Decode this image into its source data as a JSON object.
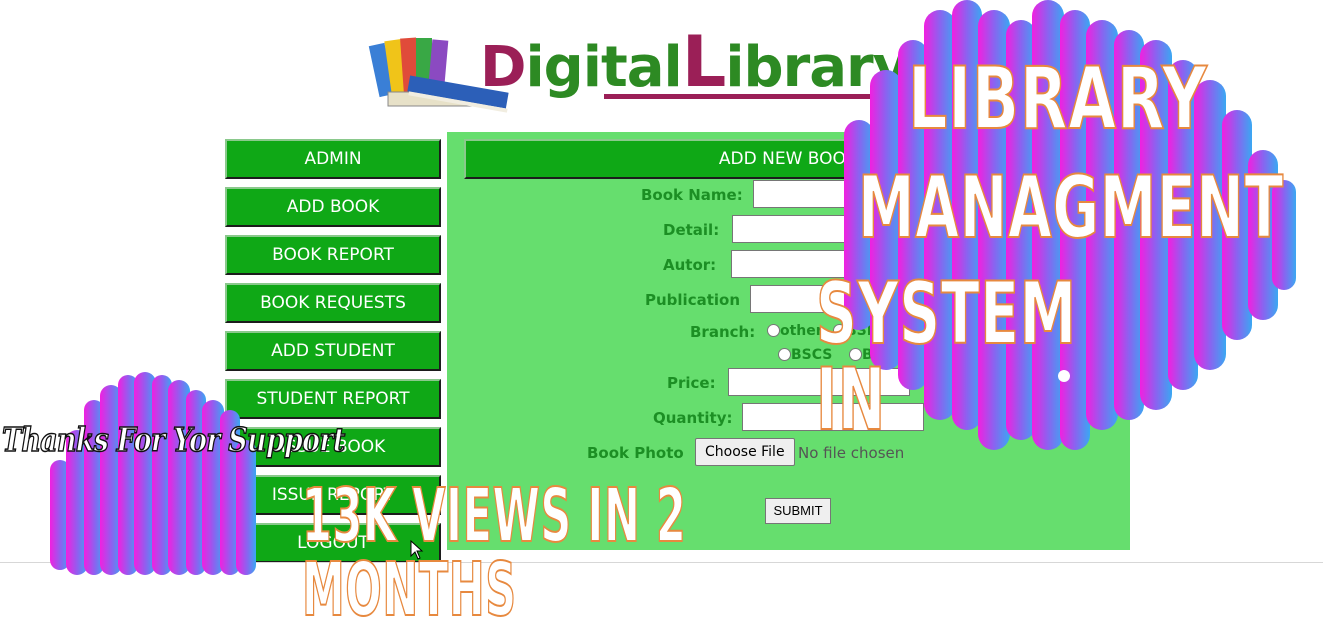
{
  "header": {
    "logo_word_part1": "Digital",
    "logo_word_part2": "Library"
  },
  "sidebar": {
    "items": [
      {
        "label": "ADMIN"
      },
      {
        "label": "ADD BOOK"
      },
      {
        "label": "BOOK REPORT"
      },
      {
        "label": "BOOK REQUESTS"
      },
      {
        "label": "ADD STUDENT"
      },
      {
        "label": "STUDENT REPORT"
      },
      {
        "label": "ISSUE BOOK"
      },
      {
        "label": "ISSUE REPORT"
      },
      {
        "label": "LOGOUT"
      }
    ]
  },
  "form": {
    "title": "ADD NEW BOOK",
    "labels": {
      "book_name": "Book Name:",
      "detail": "Detail:",
      "author": "Autor:",
      "publication": "Publication",
      "branch": "Branch:",
      "price": "Price:",
      "quantity": "Quantity:",
      "photo": "Book Photo"
    },
    "branch_options": [
      "other",
      "BSIT",
      "BSCS",
      "BSSE"
    ],
    "file_button": "Choose File",
    "file_status": "No file chosen",
    "submit_label": "SUBMIT"
  },
  "overlay": {
    "headline_line1": "LIBRARY",
    "headline_line2": "MANAGMENT",
    "headline_line3": "SYSTEM IN",
    "views_text": "13K VIEWS IN 2 MONTHS",
    "thanks_text": "Thanks For Yor Support"
  },
  "colors": {
    "nav_green": "#0fa816",
    "panel_green": "#66de6e",
    "label_green": "#1c8f24",
    "overlay_outline": "#e7893f"
  }
}
